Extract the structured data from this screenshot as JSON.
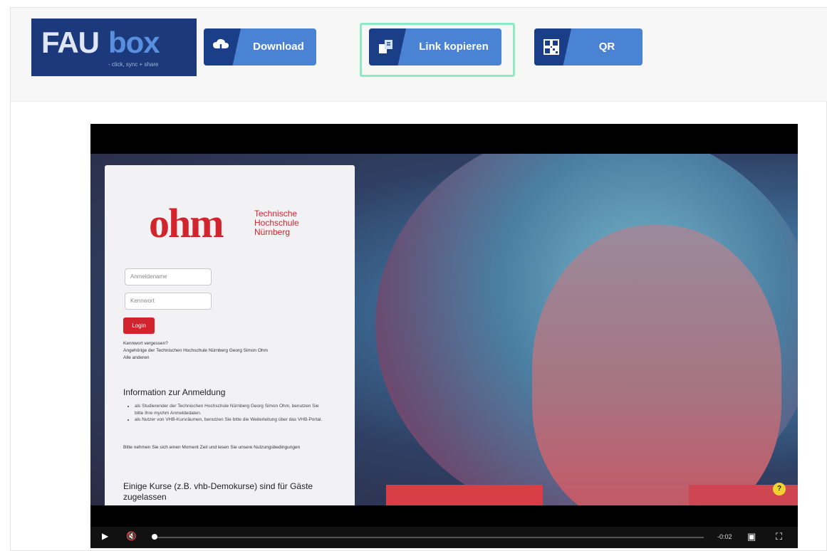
{
  "logo": {
    "brand_left": "FAU",
    "brand_right": "box",
    "tagline": "- click, sync + share"
  },
  "toolbar": {
    "download_label": "Download",
    "copy_link_label": "Link kopieren",
    "qr_label": "QR"
  },
  "video": {
    "login_page": {
      "logo_text": "ohm",
      "institution_lines": [
        "Technische",
        "Hochschule",
        "Nürnberg"
      ],
      "username_placeholder": "Anmeldename",
      "password_placeholder": "Kennwort",
      "login_button": "Login",
      "links": [
        "Kennwort vergessen?",
        "Angehörige der Technischen Hochschule Nürnberg Georg Simon Ohm",
        "Alle anderen"
      ],
      "info_heading": "Information zur Anmeldung",
      "info_bullets": [
        "als Studierender der Technischen Hochschule Nürnberg Georg Simon Ohm, benutzen Sie bitte Ihre myohm Anmeldedaten.",
        "als Nutzer von VHB-Kursräumen, benutzen Sie bitte die Weiterleitung über das VHB-Portal."
      ],
      "notice": "Bitte nehmen Sie sich einen Moment Zeit und lesen Sie unsere Nutzungsbedingungen",
      "guest_heading": "Einige Kurse (z.B. vhb-Demokurse) sind für Gäste zugelassen"
    },
    "help_label": "?",
    "player": {
      "time": "-0:02",
      "progress": 0.0
    }
  }
}
